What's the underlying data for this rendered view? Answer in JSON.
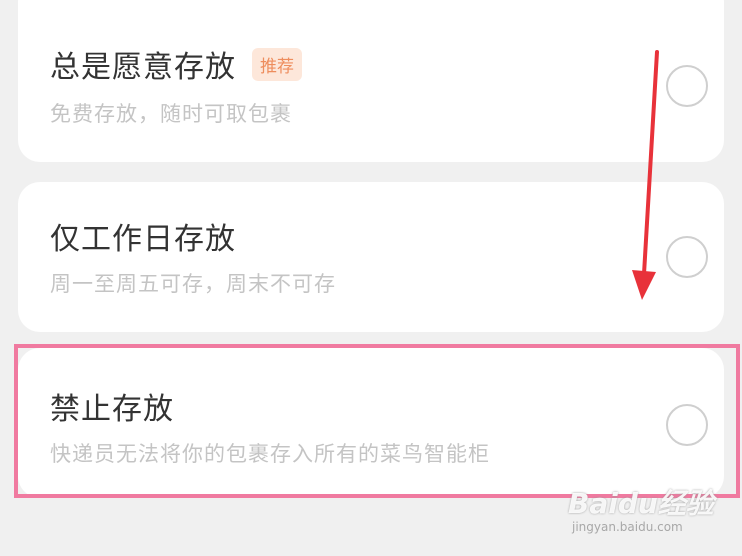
{
  "options": [
    {
      "title": "总是愿意存放",
      "badge": "推荐",
      "description": "免费存放，随时可取包裹",
      "selected": false
    },
    {
      "title": "仅工作日存放",
      "description": "周一至周五可存，周末不可存",
      "selected": false
    },
    {
      "title": "禁止存放",
      "description": "快递员无法将你的包裹存入所有的菜鸟智能柜",
      "selected": false
    }
  ],
  "watermark": {
    "brand": "Baidu经验",
    "url": "jingyan.baidu.com"
  },
  "colors": {
    "card_background": "#ffffff",
    "page_background": "#f0f0f0",
    "badge_background": "#fde7da",
    "badge_text": "#ee8d5d",
    "highlight_border": "#f07aa0",
    "annotation_arrow": "#e8323a"
  }
}
